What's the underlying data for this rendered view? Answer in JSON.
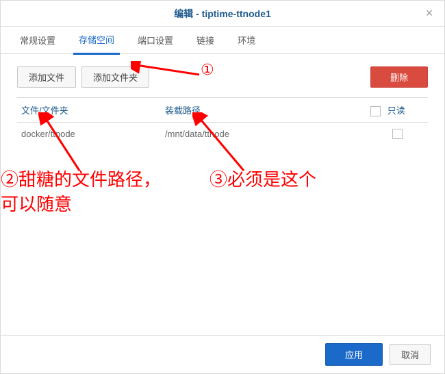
{
  "titlebar": {
    "title": "编辑 - tiptime-ttnode1",
    "close": "×"
  },
  "tabs": [
    {
      "label": "常规设置",
      "active": false
    },
    {
      "label": "存储空间",
      "active": true
    },
    {
      "label": "端口设置",
      "active": false
    },
    {
      "label": "链接",
      "active": false
    },
    {
      "label": "环境",
      "active": false
    }
  ],
  "toolbar": {
    "add_file_label": "添加文件",
    "add_folder_label": "添加文件夹",
    "delete_label": "删除"
  },
  "table": {
    "col_path": "文件/文件夹",
    "col_mount": "装载路径",
    "col_readonly": "只读",
    "rows": [
      {
        "path": "docker/ttnode",
        "mount": "/mnt/data/ttnode",
        "readonly": false
      }
    ]
  },
  "footer": {
    "apply_label": "应用",
    "cancel_label": "取消"
  },
  "annotations": {
    "num1": "①",
    "num2": "②甜糖的文件路径，",
    "num2_line2": "可以随意",
    "num3": "③必须是这个"
  }
}
